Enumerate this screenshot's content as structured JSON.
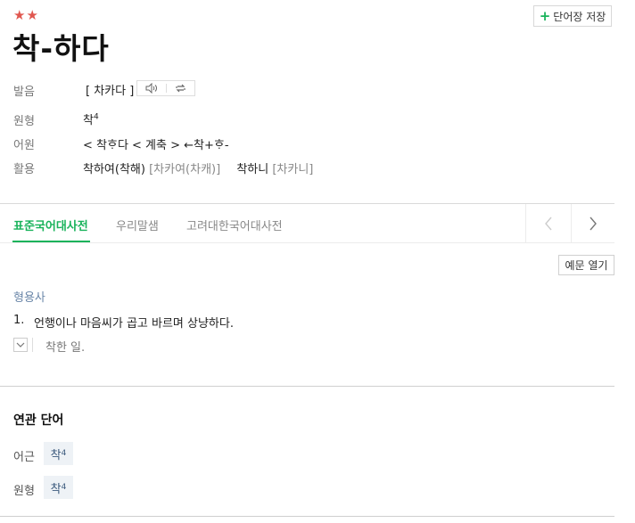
{
  "entry": {
    "stars": "★★",
    "headword": "착-하다",
    "save_label": "단어장 저장"
  },
  "info": {
    "pron_label": "발음",
    "pron_value": "[ 차카다 ]",
    "origin_label": "원형",
    "origin_value": "착",
    "origin_sup": "4",
    "etym_label": "어원",
    "etym_value": "< 착ᄒᆞ다 < 계축 > ←착+ᄒᆞ-",
    "conj_label": "활용",
    "conj_1": "착하여(착해)",
    "conj_1_pron": "[차카여(차캐)]",
    "conj_2": "착하니",
    "conj_2_pron": "[차카니]"
  },
  "tabs": [
    {
      "label": "표준국어대사전",
      "active": true
    },
    {
      "label": "우리말샘",
      "active": false
    },
    {
      "label": "고려대한국어대사전",
      "active": false
    }
  ],
  "definition": {
    "example_button": "예문 열기",
    "pos": "형용사",
    "num": "1.",
    "text": "언행이나 마음씨가 곱고 바르며 상냥하다.",
    "example": "착한 일."
  },
  "related": {
    "title": "연관 단어",
    "items": [
      {
        "label": "어근",
        "word": "착",
        "sup": "4"
      },
      {
        "label": "원형",
        "word": "착",
        "sup": "4"
      }
    ]
  },
  "icons": {
    "speaker": "speaker-icon",
    "repeat": "repeat-icon",
    "plus": "plus-icon",
    "prev": "chevron-left-icon",
    "next": "chevron-right-icon",
    "toggle": "chevron-down-icon"
  },
  "colors": {
    "accent_green": "#19b35b",
    "star_red": "#e0574f",
    "pos_blue": "#6a86a8",
    "chip_bg": "#eef2f6"
  }
}
